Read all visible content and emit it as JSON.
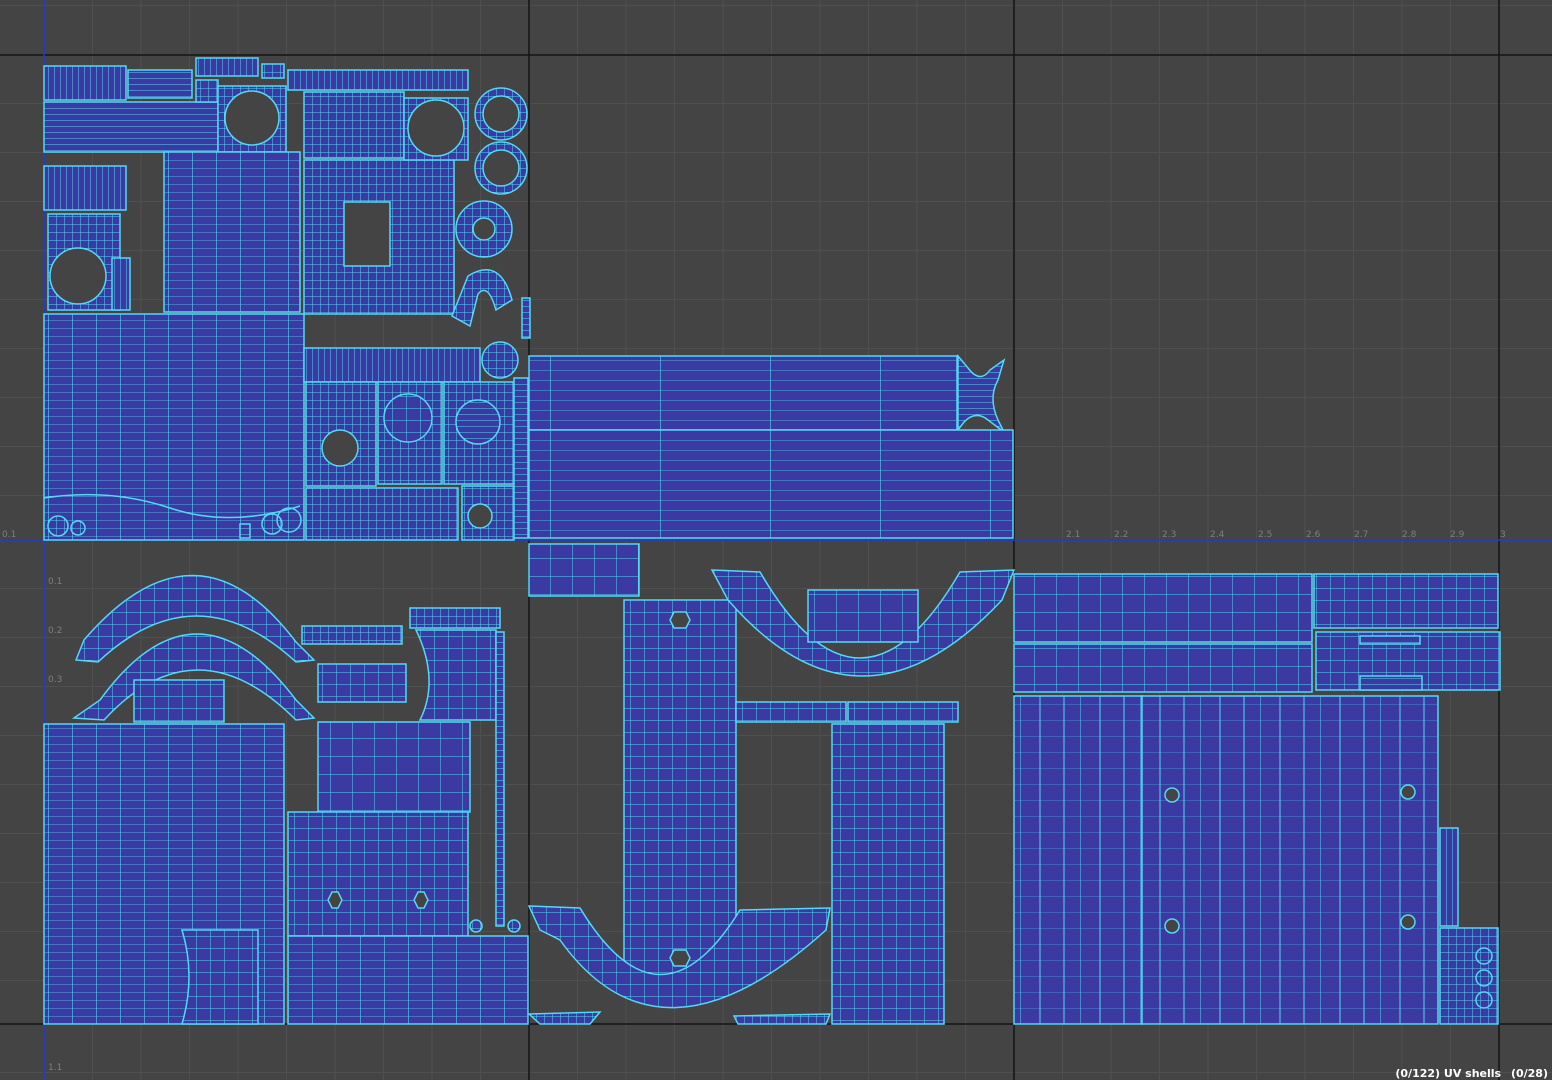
{
  "editor": {
    "view": "UV Editor",
    "grid_visible": true,
    "background_color": "#444444",
    "grid_color": "#4f4f4f",
    "tile_border_color": "#141414",
    "axis_color": "#1e3cd2",
    "shell_fill_color": "#3a3aa2",
    "shell_wire_color": "#55d8f5"
  },
  "axis_labels": {
    "u_ticks": [
      "2.1",
      "2.2",
      "2.3",
      "2.4",
      "2.5",
      "2.6",
      "2.7",
      "2.8",
      "2.9",
      "3"
    ],
    "v_ticks": [
      "0.1",
      "0.2",
      "0.3",
      "1.1"
    ],
    "left_u_tick": "0.1"
  },
  "status": {
    "shells_count": "(0/122) UV shells",
    "faces_count": "(0/28)"
  }
}
